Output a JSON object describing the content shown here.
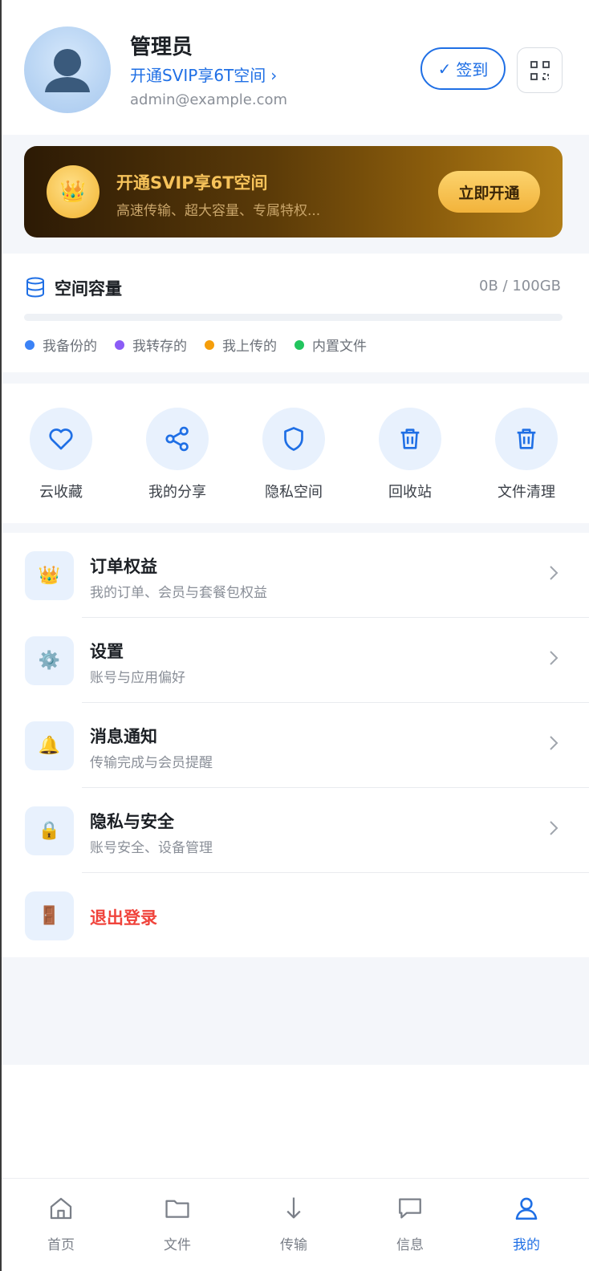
{
  "profile": {
    "name": "管理员",
    "svip_link": "开通SVIP享6T空间",
    "svip_chevron": "›",
    "email": "admin@example.com",
    "signin_check": "✓",
    "signin_label": "签到",
    "scan_icon": "scan-icon"
  },
  "banner": {
    "crown_icon": "👑",
    "title": "开通SVIP享6T空间",
    "subtitle": "高速传输、超大容量、专属特权...",
    "button": "立即开通"
  },
  "storage": {
    "title": "空间容量",
    "usage": "0B / 100GB",
    "used_fraction": 0,
    "legend": [
      {
        "label": "我备份的",
        "color": "#3b82f6"
      },
      {
        "label": "我转存的",
        "color": "#8b5cf6"
      },
      {
        "label": "我上传的",
        "color": "#f59e0b"
      },
      {
        "label": "内置文件",
        "color": "#22c55e"
      }
    ]
  },
  "quick_actions": [
    {
      "label": "云收藏",
      "icon": "heart-icon"
    },
    {
      "label": "我的分享",
      "icon": "share-icon"
    },
    {
      "label": "隐私空间",
      "icon": "shield-icon"
    },
    {
      "label": "回收站",
      "icon": "trash-icon"
    },
    {
      "label": "文件清理",
      "icon": "trash-icon"
    }
  ],
  "menu": [
    {
      "title": "订单权益",
      "subtitle": "我的订单、会员与套餐包权益",
      "icon": "👑"
    },
    {
      "title": "设置",
      "subtitle": "账号与应用偏好",
      "icon": "⚙️"
    },
    {
      "title": "消息通知",
      "subtitle": "传输完成与会员提醒",
      "icon": "🔔"
    },
    {
      "title": "隐私与安全",
      "subtitle": "账号安全、设备管理",
      "icon": "🔒"
    }
  ],
  "logout": {
    "title": "退出登录",
    "icon": "🚪"
  },
  "tabs": [
    {
      "label": "首页",
      "icon": "home-icon",
      "active": false
    },
    {
      "label": "文件",
      "icon": "folder-icon",
      "active": false
    },
    {
      "label": "传输",
      "icon": "download-arrow-icon",
      "active": false
    },
    {
      "label": "信息",
      "icon": "message-icon",
      "active": false
    },
    {
      "label": "我的",
      "icon": "user-icon",
      "active": true
    }
  ],
  "colors": {
    "accent": "#1f6fe5",
    "danger": "#f0443c",
    "gold": "#f7c35a"
  }
}
